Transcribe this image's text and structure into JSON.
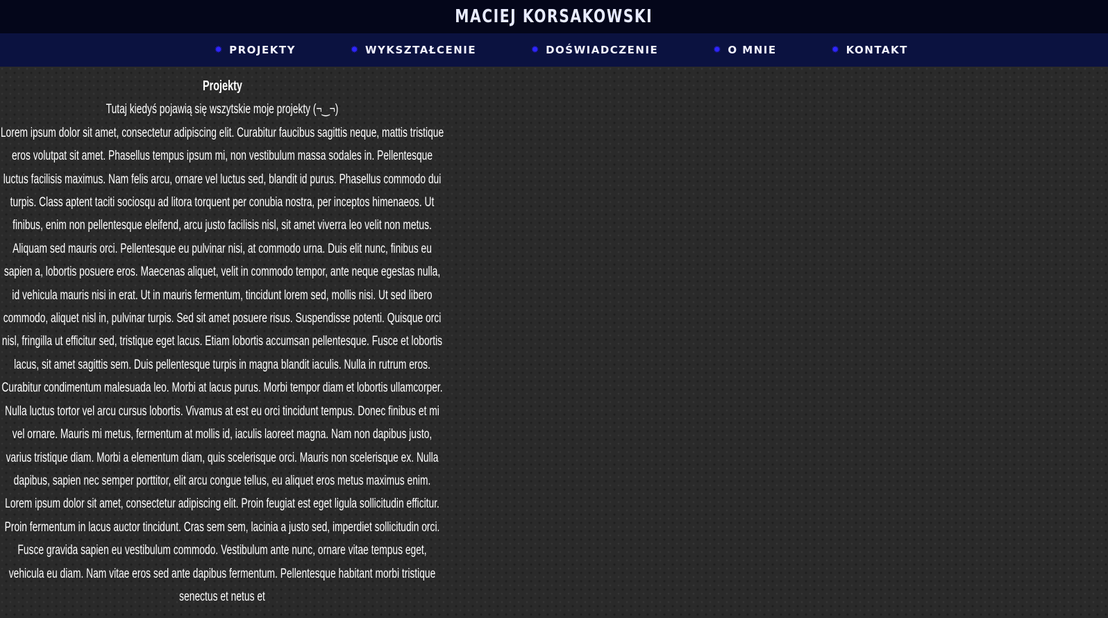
{
  "header": {
    "title": "MACIEJ KORSAKOWSKI"
  },
  "nav": {
    "items": [
      {
        "label": "PROJEKTY",
        "icon": "gear-icon"
      },
      {
        "label": "WYKSZTAŁCENIE",
        "icon": "gear-icon"
      },
      {
        "label": "DOŚWIADCZENIE",
        "icon": "gear-icon"
      },
      {
        "label": "O MNIE",
        "icon": "gear-icon"
      },
      {
        "label": "KONTAKT",
        "icon": "gear-icon"
      }
    ],
    "icon_color": "#2f25ff"
  },
  "main": {
    "section_title": "Projekty",
    "subtitle": "Tutaj kiedyś pojawią się wszytskie moje projekty (¬‿¬)",
    "body": "Lorem ipsum dolor sit amet, consectetur adipiscing elit. Curabitur faucibus sagittis neque, mattis tristique eros volutpat sit amet. Phasellus tempus ipsum mi, non vestibulum massa sodales in. Pellentesque luctus facilisis maximus. Nam felis arcu, ornare vel luctus sed, blandit id purus. Phasellus commodo dui turpis. Class aptent taciti sociosqu ad litora torquent per conubia nostra, per inceptos himenaeos. Ut finibus, enim non pellentesque eleifend, arcu justo facilisis nisl, sit amet viverra leo velit non metus. Aliquam sed mauris orci. Pellentesque eu pulvinar nisi, at commodo urna. Duis elit nunc, finibus eu sapien a, lobortis posuere eros. Maecenas aliquet, velit in commodo tempor, ante neque egestas nulla, id vehicula mauris nisi in erat. Ut in mauris fermentum, tincidunt lorem sed, mollis nisi. Ut sed libero commodo, aliquet nisl in, pulvinar turpis. Sed sit amet posuere risus. Suspendisse potenti. Quisque orci nisl, fringilla ut efficitur sed, tristique eget lacus. Etiam lobortis accumsan pellentesque. Fusce et lobortis lacus, sit amet sagittis sem. Duis pellentesque turpis in magna blandit iaculis. Nulla in rutrum eros. Curabitur condimentum malesuada leo. Morbi at lacus purus. Morbi tempor diam et lobortis ullamcorper. Nulla luctus tortor vel arcu cursus lobortis. Vivamus at est eu orci tincidunt tempus. Donec finibus et mi vel ornare. Mauris mi metus, fermentum at mollis id, iaculis laoreet magna. Nam non dapibus justo, varius tristique diam. Morbi a elementum diam, quis scelerisque orci. Mauris non scelerisque ex. Nulla dapibus, sapien nec semper porttitor, elit arcu congue tellus, eu aliquet eros metus maximus enim. Lorem ipsum dolor sit amet, consectetur adipiscing elit. Proin feugiat est eget ligula sollicitudin efficitur. Proin fermentum in lacus auctor tincidunt. Cras sem sem, lacinia a justo sed, imperdiet sollicitudin orci. Fusce gravida sapien eu vestibulum commodo. Vestibulum ante nunc, ornare vitae tempus eget, vehicula eu diam. Nam vitae eros sed ante dapibus fermentum. Pellentesque habitant morbi tristique senectus et netus et"
  }
}
